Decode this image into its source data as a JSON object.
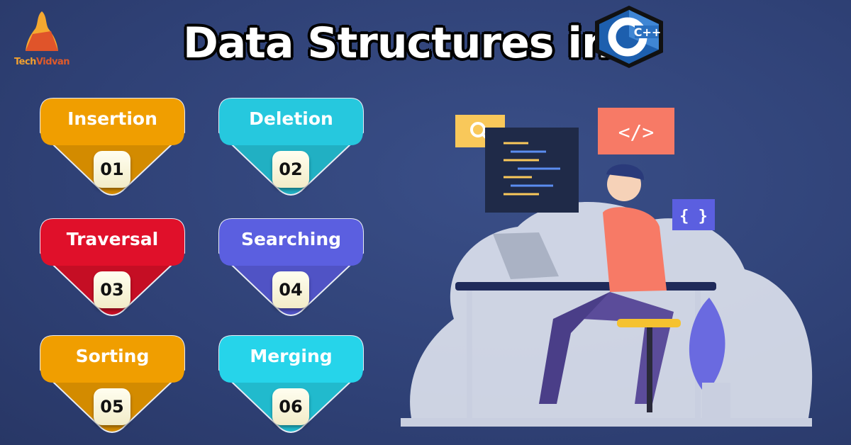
{
  "brand": {
    "name_part1": "Tech",
    "name_part2": "Vidvan"
  },
  "title": "Data Structures in",
  "logo_text": "C++",
  "operations": [
    {
      "label": "Insertion",
      "number": "01",
      "color": "#f09e00"
    },
    {
      "label": "Deletion",
      "number": "02",
      "color": "#26c8de"
    },
    {
      "label": "Traversal",
      "number": "03",
      "color": "#e0102a"
    },
    {
      "label": "Searching",
      "number": "04",
      "color": "#5b5fe0"
    },
    {
      "label": "Sorting",
      "number": "05",
      "color": "#f09e00"
    },
    {
      "label": "Merging",
      "number": "06",
      "color": "#26d4ea"
    }
  ],
  "illustration": {
    "code_tag": "</>",
    "braces": "{ }",
    "search_icon": "magnifier-icon"
  }
}
